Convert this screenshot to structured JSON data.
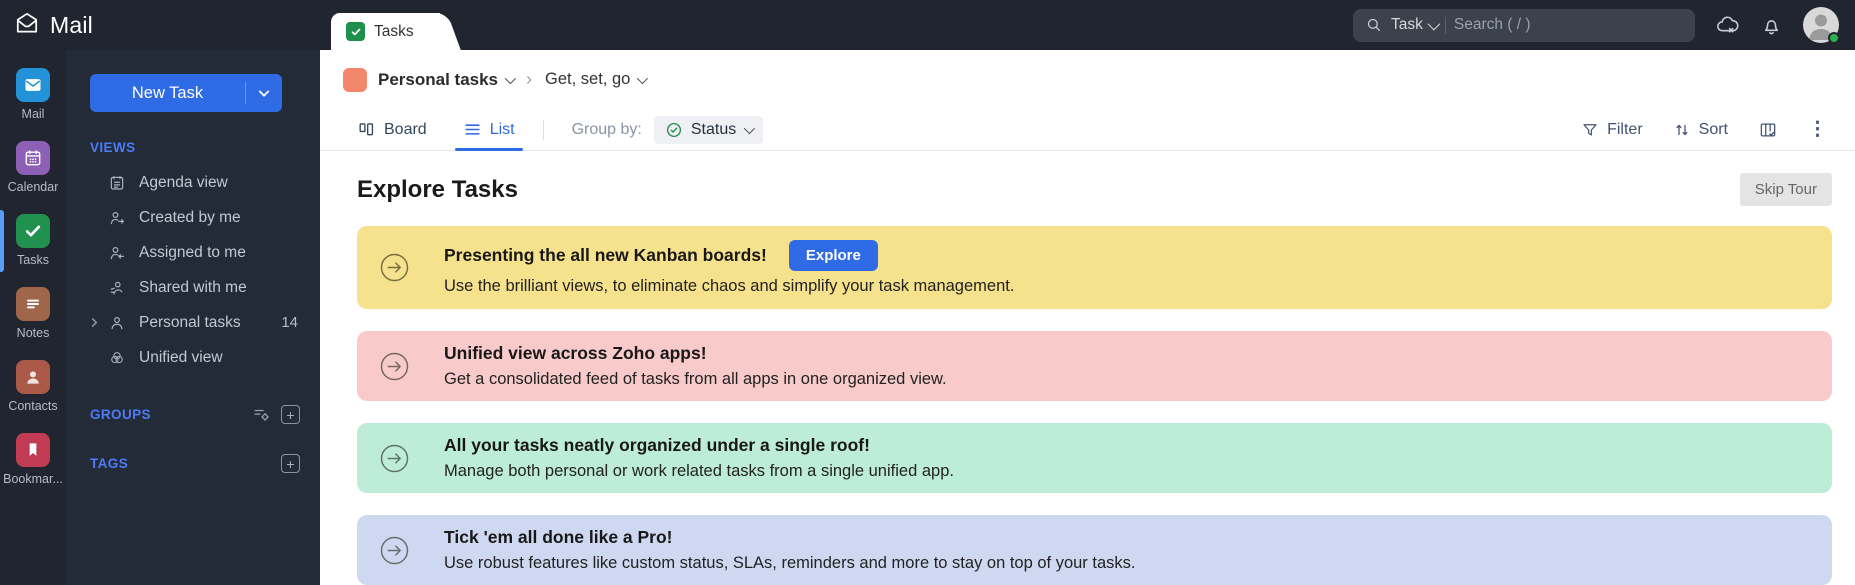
{
  "topbar": {
    "app_title": "Mail",
    "search_scope": "Task",
    "search_placeholder": "Search ( / )"
  },
  "rail": {
    "items": [
      {
        "label": "Mail",
        "color": "#2492d6"
      },
      {
        "label": "Calendar",
        "color": "#8d60b5"
      },
      {
        "label": "Tasks",
        "color": "#21914f"
      },
      {
        "label": "Notes",
        "color": "#a0664b"
      },
      {
        "label": "Contacts",
        "color": "#ab5a49"
      },
      {
        "label": "Bookmar...",
        "color": "#c23b55"
      }
    ]
  },
  "sidebar": {
    "new_task_label": "New Task",
    "views_header": "VIEWS",
    "views": [
      {
        "label": "Agenda view"
      },
      {
        "label": "Created by me"
      },
      {
        "label": "Assigned to me"
      },
      {
        "label": "Shared with me"
      },
      {
        "label": "Personal tasks",
        "count": "14"
      },
      {
        "label": "Unified view"
      }
    ],
    "groups_header": "GROUPS",
    "tags_header": "TAGS"
  },
  "main": {
    "tab_label": "Tasks",
    "breadcrumb_parent": "Personal tasks",
    "breadcrumb_current": "Get, set, go",
    "toolbar": {
      "board_label": "Board",
      "list_label": "List",
      "group_by_label": "Group by:",
      "group_by_value": "Status",
      "filter_label": "Filter",
      "sort_label": "Sort"
    },
    "heading": "Explore Tasks",
    "skip_tour_label": "Skip Tour",
    "explore_button_label": "Explore",
    "banners": [
      {
        "bg": "#f6e18c",
        "title": "Presenting the all new Kanban boards!",
        "subtitle": "Use the brilliant views, to eliminate chaos and simplify your task management."
      },
      {
        "bg": "#f8caca",
        "title": "Unified view across Zoho apps!",
        "subtitle": "Get a consolidated feed of tasks from all apps in one organized view."
      },
      {
        "bg": "#bdecd9",
        "title": "All your tasks neatly organized under a single roof!",
        "subtitle": "Manage both personal or work related tasks from a single unified app."
      },
      {
        "bg": "#ced9f1",
        "title": "Tick 'em all done like a Pro!",
        "subtitle": "Use robust features like custom status, SLAs, reminders and more to stay on top of your tasks."
      }
    ]
  },
  "colors": {
    "accent": "#2f6be4",
    "active_indicator": "#5a9cf8",
    "breadcrumb_swatch": "#f2876b",
    "tab_check_green": "#1f8f4e"
  }
}
